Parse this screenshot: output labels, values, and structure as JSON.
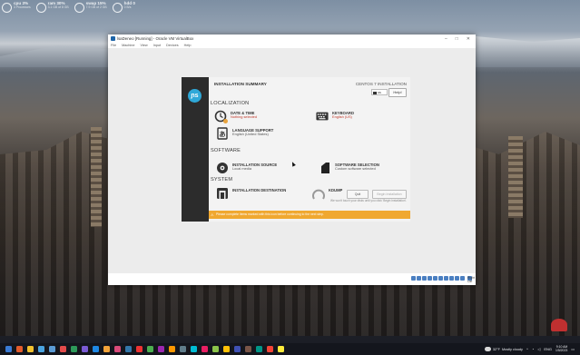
{
  "desktop": {
    "widgets": [
      {
        "big": "cpu 3%",
        "small": "3 Processes",
        "name": "cpu-widget"
      },
      {
        "big": "ram 30%",
        "small": "3.1 GB of 8 GB",
        "name": "ram-widget"
      },
      {
        "big": "swap 15%",
        "small": "7.9 GB of 2 GB",
        "name": "swap-widget"
      },
      {
        "big": "hdd 0",
        "small": "0 B/s",
        "name": "hdd-widget"
      }
    ]
  },
  "vbox": {
    "title": "lsaDeneo [Running] - Oracle VM VirtualBox",
    "menu": [
      "File",
      "Machine",
      "View",
      "Input",
      "Devices",
      "Help"
    ],
    "window_controls": [
      "–",
      "□",
      "✕"
    ],
    "status_right": "Right Ctrl"
  },
  "installer": {
    "logo": "ɲs",
    "summary_title": "INSTALLATION SUMMARY",
    "product_title": "CENTOS 7 INSTALLATION",
    "keyboard_badge": "us",
    "help_label": "Help!",
    "sections": {
      "localization": "LOCALIZATION",
      "software": "SOFTWARE",
      "system": "SYSTEM"
    },
    "spokes": {
      "datetime": {
        "title": "DATE & TIME",
        "status": "Nothing selected",
        "icon": "clock-icon"
      },
      "keyboard": {
        "title": "KEYBOARD",
        "status": "English (US)",
        "icon": "keyboard-icon"
      },
      "language": {
        "title": "LANGUAGE SUPPORT",
        "status": "English (United States)",
        "icon": "language-icon"
      },
      "source": {
        "title": "INSTALLATION SOURCE",
        "status": "Local media",
        "icon": "disc-icon"
      },
      "software": {
        "title": "SOFTWARE SELECTION",
        "status": "Custom software selected",
        "icon": "package-icon"
      },
      "destination": {
        "title": "INSTALLATION DESTINATION",
        "status": "",
        "icon": "harddisk-icon"
      },
      "kdump": {
        "title": "KDUMP",
        "status": "",
        "icon": "kdump-icon"
      }
    },
    "quit_label": "Quit",
    "begin_label": "Begin Installation",
    "footer_note": "We won't touch your disks until you click 'Begin Installation'.",
    "warning_text": "Please complete items marked with this icon before continuing to the next step."
  },
  "taskbar": {
    "weather_temp": "32°F",
    "weather_desc": "Mostly cloudy",
    "tray_lang": "ENG",
    "time": "9:10 AM",
    "date": "1/5/2023",
    "icon_colors": [
      "#3a7bd5",
      "#e35b2c",
      "#f2c12e",
      "#4aa3df",
      "#5b9bd5",
      "#e34b4b",
      "#2d9a5a",
      "#7a5bd5",
      "#1e88e5",
      "#f2a33a",
      "#d84a7a",
      "#37a",
      "#e33",
      "#4caf50",
      "#9c27b0",
      "#ff9800",
      "#607d8b",
      "#00bcd4",
      "#e91e63",
      "#8bc34a",
      "#ffc107",
      "#3f51b5",
      "#795548",
      "#009688",
      "#f44336",
      "#ffeb3b"
    ]
  }
}
